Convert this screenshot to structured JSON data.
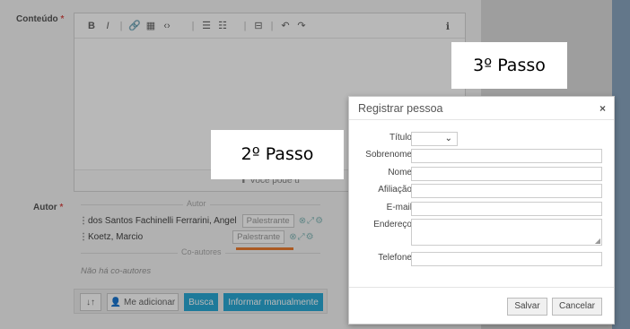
{
  "background": {
    "conteudo_label": "Conteúdo",
    "required_mark": "*",
    "autor_label": "Autor",
    "toolbar": [
      "B",
      "I",
      "|",
      "🔗",
      "▦",
      "‹›",
      "|",
      "☰",
      "☷",
      "|",
      "⊟",
      "|",
      "↶",
      "↷"
    ],
    "info_icon": "ℹ",
    "editor_footer": "⬆ Você pode u",
    "authors_divider": "Autor",
    "coauthors_divider": "Co-autores",
    "authors": [
      {
        "name": "dos Santos Fachinelli Ferrarini, Angel",
        "role": "Palestrante"
      },
      {
        "name": "Koetz, Marcio",
        "role": "Palestrante"
      }
    ],
    "no_coauthors": "Não há co-autores",
    "buttons": {
      "sort": "↓↑",
      "add_me": "Me adicionar",
      "search": "Busca",
      "manual": "Informar manualmente"
    }
  },
  "callouts": {
    "step2": "2º Passo",
    "step3": "3º Passo"
  },
  "modal": {
    "title": "Registrar pessoa",
    "close": "×",
    "fields": {
      "titulo": "Título",
      "sobrenome": "Sobrenome",
      "nome": "Nome",
      "afiliacao": "Afiliação",
      "email": "E-mail",
      "endereco": "Endereço",
      "telefone": "Telefone"
    },
    "save": "Salvar",
    "cancel": "Cancelar"
  },
  "colors": {
    "accent": "#2aa9d6",
    "highlight": "#ed7d31",
    "required": "#d9534f"
  }
}
